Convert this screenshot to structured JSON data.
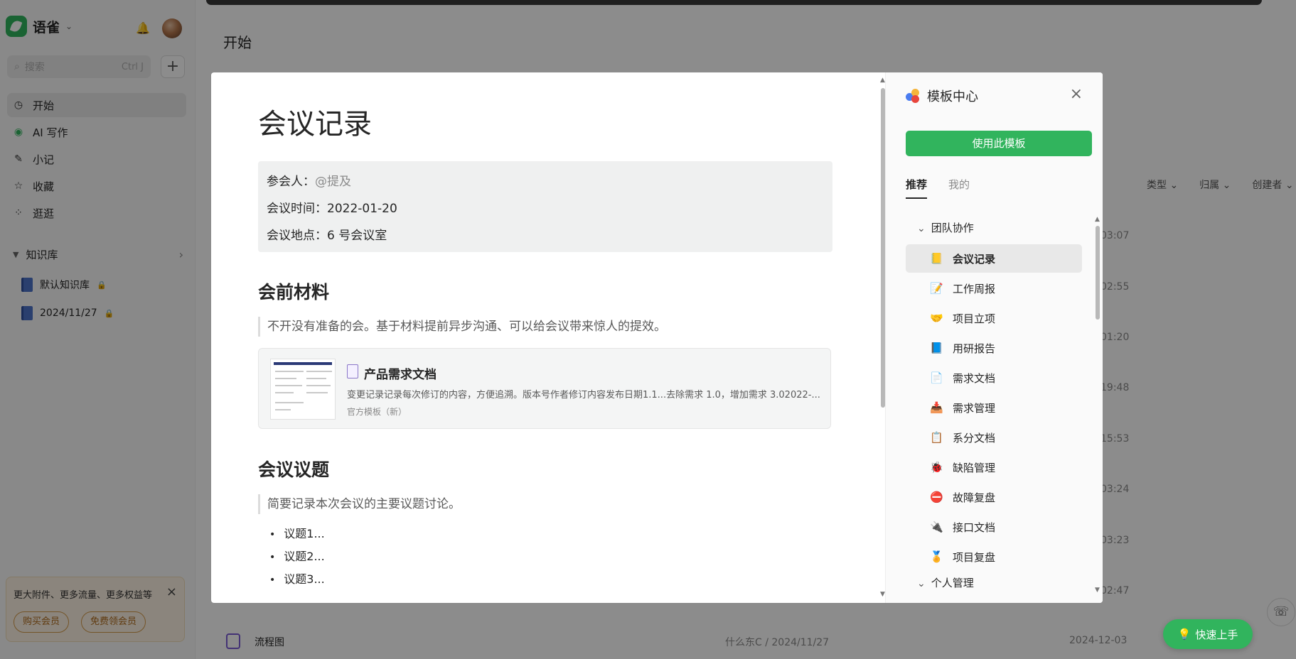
{
  "app": {
    "brand": "语雀",
    "search_placeholder": "搜索",
    "search_shortcut": "Ctrl J"
  },
  "sidebar": {
    "nav": [
      {
        "label": "开始",
        "icon": "clock-icon"
      },
      {
        "label": "AI 写作",
        "icon": "ai-icon"
      },
      {
        "label": "小记",
        "icon": "feather-icon"
      },
      {
        "label": "收藏",
        "icon": "star-icon"
      },
      {
        "label": "逛逛",
        "icon": "grid-icon"
      }
    ],
    "kb_section": "知识库",
    "books": [
      {
        "label": "默认知识库"
      },
      {
        "label": "2024/11/27"
      }
    ],
    "promo": {
      "text": "更大附件、更多流量、更多权益等",
      "buy": "购买会员",
      "free": "免费领会员"
    }
  },
  "main": {
    "title": "开始",
    "filters": [
      "类型",
      "归属",
      "创建者"
    ],
    "times": [
      "03:07",
      "02:55",
      "01:20",
      "19:48",
      "15:53",
      "03:24",
      "03:23",
      "02:47"
    ],
    "bottom_row": {
      "name": "流程图",
      "owner": "什么东C / 2024/11/27",
      "date": "2024-12-03"
    },
    "quick_start": "快速上手"
  },
  "preview": {
    "title": "会议记录",
    "info": {
      "participants_label": "参会人：",
      "participants_value": "@提及",
      "time_label": "会议时间：",
      "time_value": "2022-01-20",
      "place_label": "会议地点：",
      "place_value": "6 号会议室"
    },
    "section1": "会前材料",
    "quote1": "不开没有准备的会。基于材料提前异步沟通、可以给会议带来惊人的提效。",
    "card": {
      "title": "产品需求文档",
      "desc": "变更记录记录每次修订的内容，方便追溯。版本号作者修订内容发布日期1.1...去除需求 1.0，增加需求 3.02022-...",
      "tag": "官方模板（新）"
    },
    "section2": "会议议题",
    "quote2": "简要记录本次会议的主要议题讨论。",
    "bullets": [
      "议题1...",
      "议题2...",
      "议题3..."
    ]
  },
  "panel": {
    "title": "模板中心",
    "use_button": "使用此模板",
    "tabs": [
      "推荐",
      "我的"
    ],
    "group1": "团队协作",
    "items": [
      {
        "label": "会议记录",
        "icon": "notebook-icon",
        "glyph": "📒"
      },
      {
        "label": "工作周报",
        "icon": "memo-icon",
        "glyph": "📝"
      },
      {
        "label": "项目立项",
        "icon": "handshake-icon",
        "glyph": "🤝"
      },
      {
        "label": "用研报告",
        "icon": "blue-book-icon",
        "glyph": "📘"
      },
      {
        "label": "需求文档",
        "icon": "page-icon",
        "glyph": "📄"
      },
      {
        "label": "需求管理",
        "icon": "inbox-icon",
        "glyph": "📥"
      },
      {
        "label": "系分文档",
        "icon": "clipboard-icon",
        "glyph": "📋"
      },
      {
        "label": "缺陷管理",
        "icon": "ladybug-icon",
        "glyph": "🐞"
      },
      {
        "label": "故障复盘",
        "icon": "no-entry-icon",
        "glyph": "⛔"
      },
      {
        "label": "接口文档",
        "icon": "plug-icon",
        "glyph": "🔌"
      },
      {
        "label": "项目复盘",
        "icon": "medal-icon",
        "glyph": "🏅"
      }
    ],
    "group2": "个人管理"
  }
}
